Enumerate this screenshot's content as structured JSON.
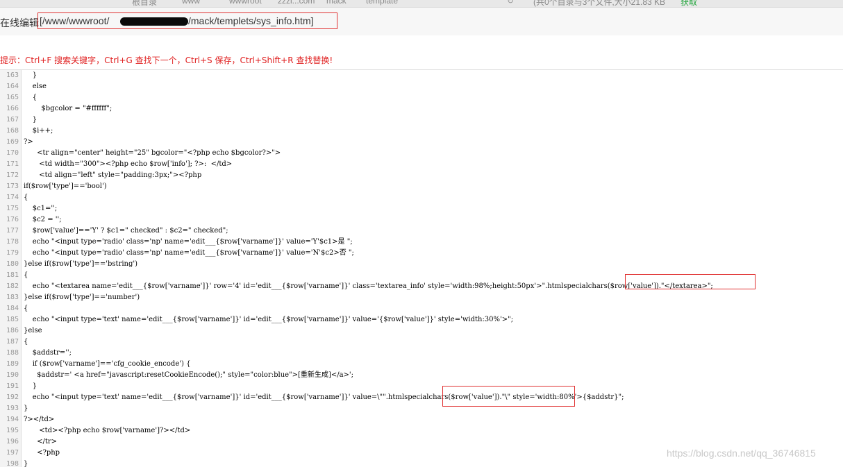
{
  "header": {
    "label": "在线编辑",
    "path_prefix": "[/www/wwwroot/",
    "path_suffix": "/mack/templets/sys_info.htm]"
  },
  "browser_fragments": [
    "根目录",
    "www",
    "wwwroot",
    "zzzi...com",
    "mack",
    "template",
    "(共0个目录与3个文件,大小21.83 KB",
    "获取"
  ],
  "hint": "提示：Ctrl+F 搜索关键字，Ctrl+G 查找下一个，Ctrl+S 保存，Ctrl+Shift+R 查找替换!",
  "lines": [
    {
      "n": "163",
      "t": "    }"
    },
    {
      "n": "164",
      "t": "    else"
    },
    {
      "n": "165",
      "t": "    {"
    },
    {
      "n": "166",
      "t": "        $bgcolor = \"#ffffff\";"
    },
    {
      "n": "167",
      "t": "    }"
    },
    {
      "n": "168",
      "t": "    $i++;"
    },
    {
      "n": "169",
      "t": "?>"
    },
    {
      "n": "170",
      "t": "      <tr align=\"center\" height=\"25\" bgcolor=\"<?php echo $bgcolor?>\">"
    },
    {
      "n": "171",
      "t": "       <td width=\"300\"><?php echo $row['info']; ?>:  </td>"
    },
    {
      "n": "172",
      "t": "       <td align=\"left\" style=\"padding:3px;\"><?php"
    },
    {
      "n": "173",
      "t": "if($row['type']=='bool')"
    },
    {
      "n": "174",
      "t": "{"
    },
    {
      "n": "175",
      "t": "    $c1='';"
    },
    {
      "n": "176",
      "t": "    $c2 = '';"
    },
    {
      "n": "177",
      "t": "    $row['value']=='Y' ? $c1=\" checked\" : $c2=\" checked\";"
    },
    {
      "n": "178",
      "t": "    echo \"<input type='radio' class='np' name='edit___{$row['varname']}' value='Y'$c1>是 \";"
    },
    {
      "n": "179",
      "t": "    echo \"<input type='radio' class='np' name='edit___{$row['varname']}' value='N'$c2>否 \";"
    },
    {
      "n": "180",
      "t": "}else if($row['type']=='bstring')"
    },
    {
      "n": "181",
      "t": "{"
    },
    {
      "n": "182",
      "t": "    echo \"<textarea name='edit___{$row['varname']}' row='4' id='edit___{$row['varname']}' class='textarea_info' style='width:98%;height:50px'>\".htmlspecialchars($row['value']).\"</textarea>\";"
    },
    {
      "n": "183",
      "t": "}else if($row['type']=='number')"
    },
    {
      "n": "184",
      "t": "{"
    },
    {
      "n": "185",
      "t": "    echo \"<input type='text' name='edit___{$row['varname']}' id='edit___{$row['varname']}' value='{$row['value']}' style='width:30%'>\";"
    },
    {
      "n": "186",
      "t": "}else"
    },
    {
      "n": "187",
      "t": "{"
    },
    {
      "n": "188",
      "t": "    $addstr='';"
    },
    {
      "n": "189",
      "t": "    if ($row['varname']=='cfg_cookie_encode') {"
    },
    {
      "n": "190",
      "t": "      $addstr=' <a href=\"javascript:resetCookieEncode();\" style=\"color:blue\">[重新生成]</a>';"
    },
    {
      "n": "191",
      "t": "    }"
    },
    {
      "n": "192",
      "t": "    echo \"<input type='text' name='edit___{$row['varname']}' id='edit___{$row['varname']}' value=\\\"\".htmlspecialchars($row['value']).\"\\\" style='width:80%'>{$addstr}\";"
    },
    {
      "n": "193",
      "t": "}"
    },
    {
      "n": "194",
      "t": "?></td>"
    },
    {
      "n": "195",
      "t": "       <td><?php echo $row['varname']?></td>"
    },
    {
      "n": "196",
      "t": "      </tr>"
    },
    {
      "n": "197",
      "t": "      <?php"
    },
    {
      "n": "198",
      "t": "}"
    }
  ],
  "watermark": "https://blog.csdn.net/qq_36746815"
}
